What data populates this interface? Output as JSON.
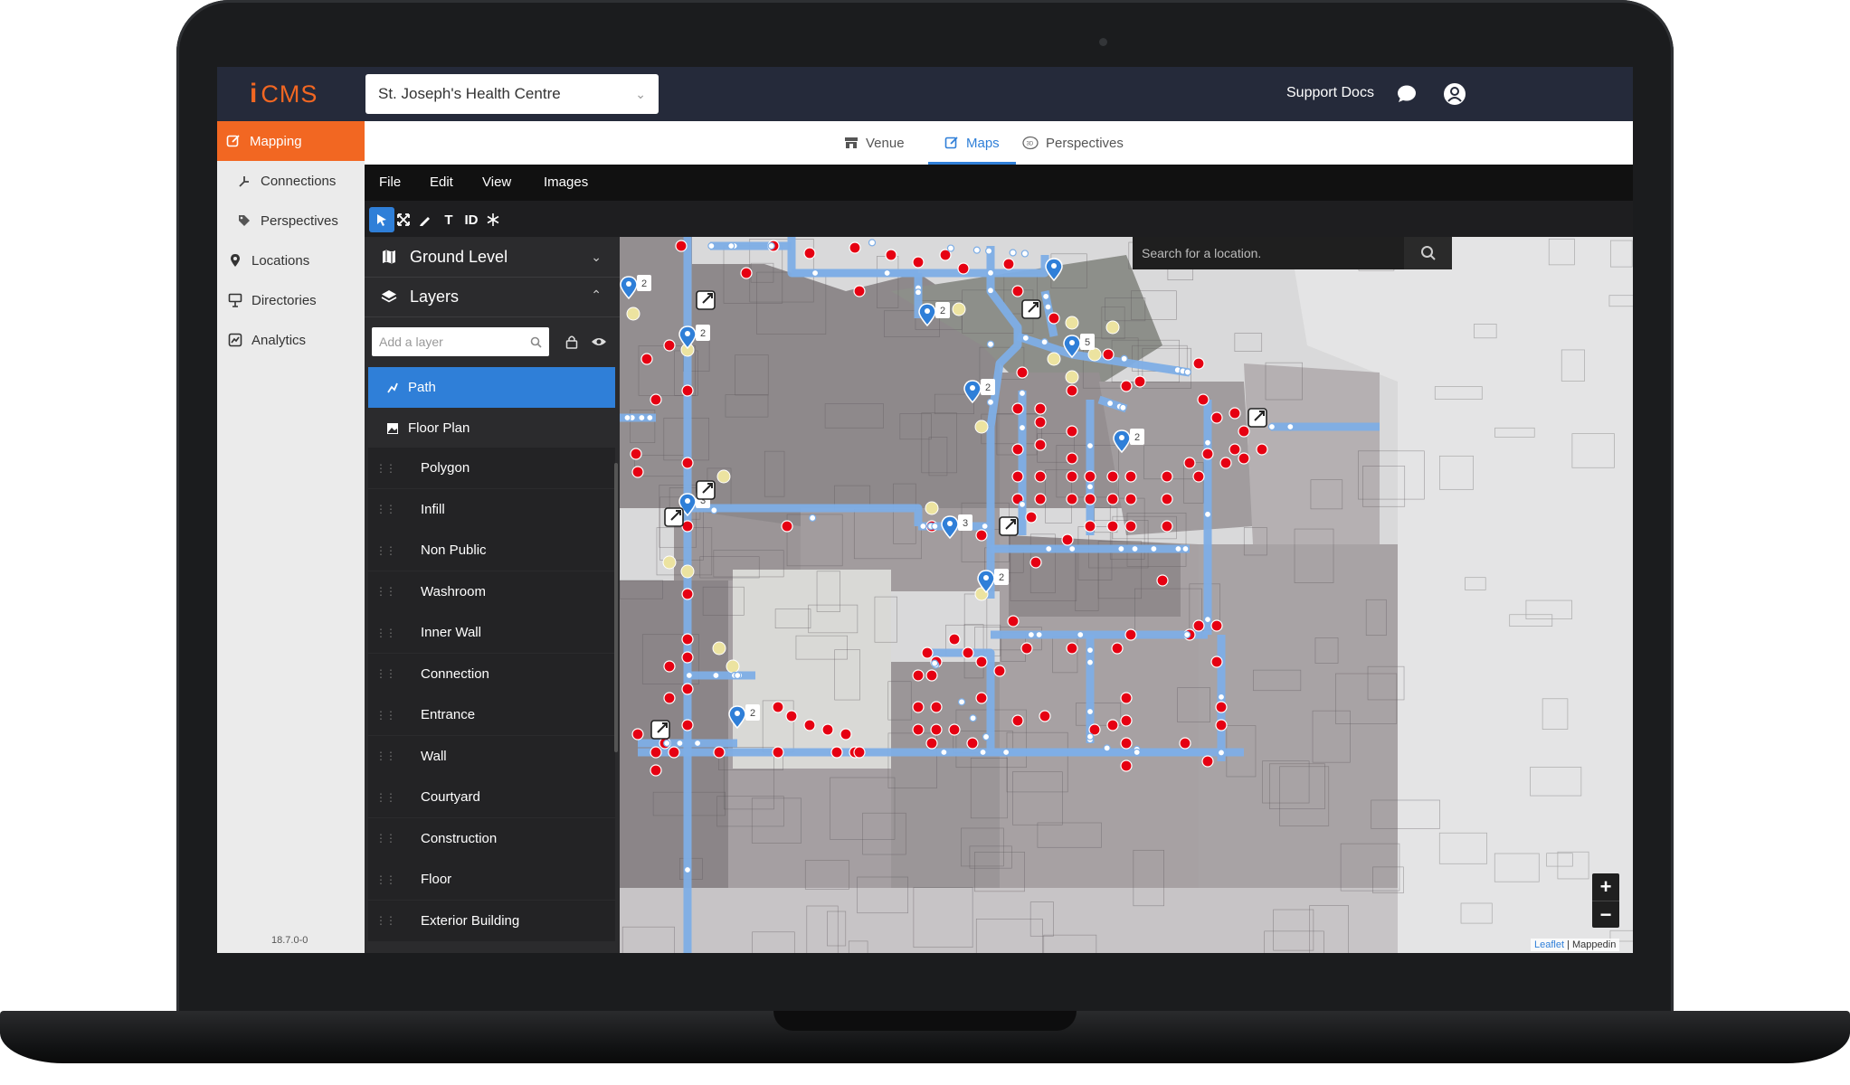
{
  "app": {
    "logo_mark": "i",
    "logo_text": "CMS"
  },
  "header": {
    "venue": "St. Joseph's Health Centre",
    "support_label": "Support Docs"
  },
  "nav": {
    "items": [
      {
        "label": "Mapping",
        "icon": "edit-icon",
        "active": true
      },
      {
        "label": "Connections",
        "icon": "connection-icon"
      },
      {
        "label": "Perspectives",
        "icon": "tag-icon"
      },
      {
        "label": "Locations",
        "icon": "pin-icon"
      },
      {
        "label": "Directories",
        "icon": "directory-icon"
      },
      {
        "label": "Analytics",
        "icon": "analytics-icon"
      }
    ],
    "version": "18.7.0-0"
  },
  "tabs": [
    {
      "label": "Venue",
      "icon": "store-icon"
    },
    {
      "label": "Maps",
      "icon": "edit-icon",
      "active": true
    },
    {
      "label": "Perspectives",
      "icon": "3d-icon"
    }
  ],
  "menu": [
    "File",
    "Edit",
    "View",
    "Images"
  ],
  "tools": [
    "select-tool",
    "move-tool",
    "pen-tool",
    "text-tool",
    "id-tool",
    "snowflake-tool"
  ],
  "tool_labels": {
    "text": "T",
    "id": "ID"
  },
  "panel": {
    "level": "Ground Level",
    "layers_title": "Layers",
    "layer_search_placeholder": "Add a layer",
    "pinned_layers": [
      {
        "label": "Path",
        "selected": true
      },
      {
        "label": "Floor Plan"
      }
    ],
    "layers": [
      "Polygon",
      "Infill",
      "Non Public",
      "Washroom",
      "Inner Wall",
      "Connection",
      "Entrance",
      "Wall",
      "Courtyard",
      "Construction",
      "Floor",
      "Exterior Building"
    ]
  },
  "map": {
    "search_placeholder": "Search for a location.",
    "zoom_in": "+",
    "zoom_out": "−",
    "attribution_leaflet": "Leaflet",
    "attribution_rest": "| Mappedin",
    "pin_counts": [
      "2",
      "2",
      "5",
      "2",
      "2",
      "3",
      "3",
      "2",
      "2",
      "2",
      "2"
    ],
    "colors": {
      "path": "#7eaee6",
      "node_red": "#e60012",
      "node_yellow": "#ece3a0",
      "node_white": "#ffffff",
      "pin_blue": "#2f7fd8"
    }
  },
  "colors": {
    "accent": "#f26722",
    "topbar": "#252a3a",
    "primary": "#2f7fd8"
  }
}
